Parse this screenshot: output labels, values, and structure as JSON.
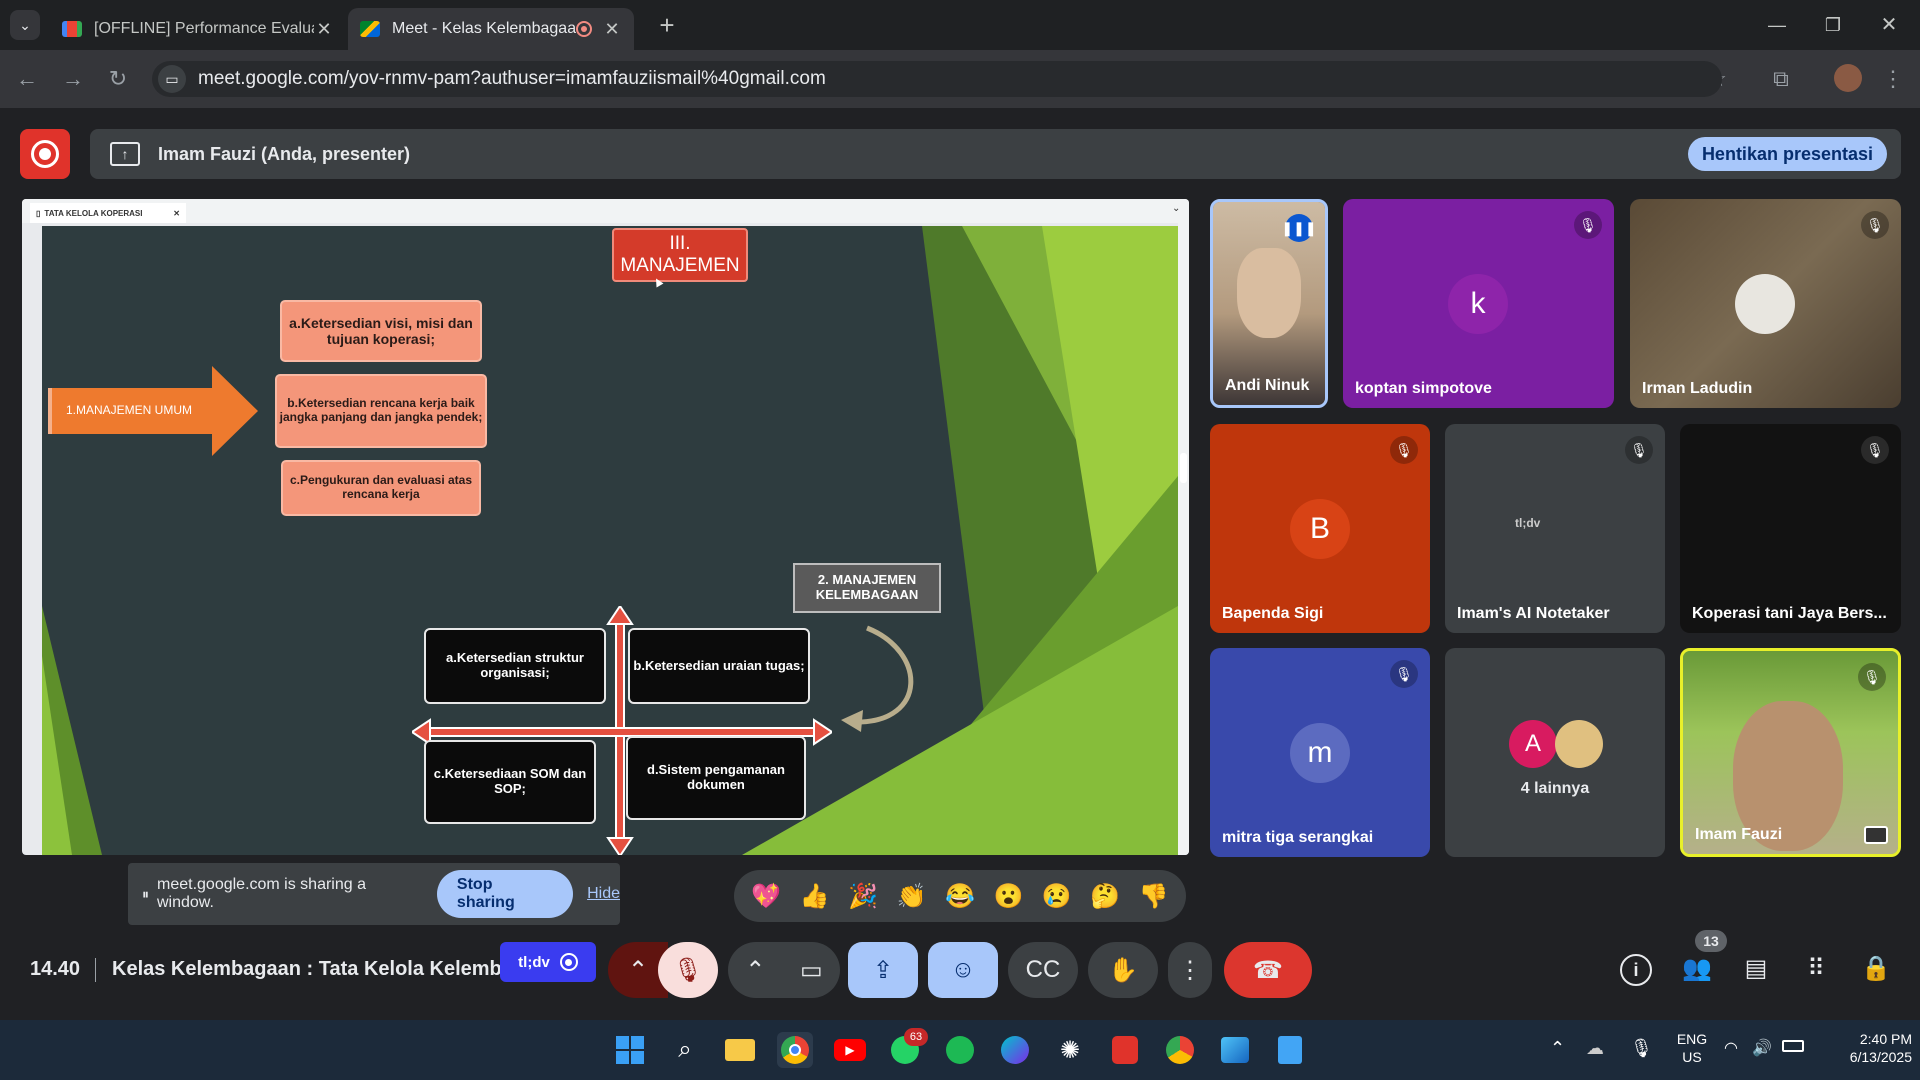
{
  "browser": {
    "tabs": [
      {
        "title": "[OFFLINE] Performance Evaluati",
        "favicon": "gmail-icon"
      },
      {
        "title": "Meet - Kelas Kelembagaan",
        "favicon": "meet-icon"
      }
    ],
    "url": "meet.google.com/yov-rnmv-pam?authuser=imamfauziismail%40gmail.com"
  },
  "presenter": {
    "label": "Imam Fauzi (Anda, presenter)",
    "stop_button": "Hentikan presentasi"
  },
  "shared_window": {
    "tab_title": "TATA KELOLA KOPERASI",
    "slide": {
      "title": "III. MANAJEMEN",
      "arrow_label": "1.MANAJEMEN UMUM",
      "box_a": "a.Ketersedian visi, misi dan tujuan koperasi;",
      "box_b": "b.Ketersedian rencana kerja baik jangka panjang dan jangka pendek;",
      "box_c": "c.Pengukuran dan evaluasi atas rencana kerja",
      "section2": "2. MANAJEMEN KELEMBAGAAN",
      "q_a": "a.Ketersedian struktur organisasi;",
      "q_b": "b.Ketersedian uraian tugas;",
      "q_c": "c.Ketersediaan SOM dan SOP;",
      "q_d": "d.Sistem pengamanan dokumen"
    }
  },
  "participants": [
    {
      "name": "Andi Ninuk",
      "initial": ""
    },
    {
      "name": "koptan simpotove",
      "initial": "k"
    },
    {
      "name": "Irman Ladudin",
      "initial": ""
    },
    {
      "name": "Bapenda Sigi",
      "initial": "B"
    },
    {
      "name": "Imam's AI Notetaker",
      "initial": "",
      "logo": "tl;dv"
    },
    {
      "name": "Koperasi tani Jaya Bers...",
      "initial": ""
    },
    {
      "name": "mitra tiga serangkai",
      "initial": "m"
    },
    {
      "name": "4 lainnya",
      "initial": "A"
    },
    {
      "name": "Imam Fauzi",
      "initial": ""
    }
  ],
  "sharing_notice": {
    "text": "meet.google.com is sharing a window.",
    "stop": "Stop sharing",
    "hide": "Hide"
  },
  "reactions": [
    "💖",
    "👍",
    "🎉",
    "👏",
    "😂",
    "😮",
    "😢",
    "🤔",
    "👎"
  ],
  "meeting": {
    "time": "14.40",
    "title": "Kelas Kelembagaan : Tata Kelola Kelembagaan",
    "tldv_label": "tl;dv",
    "people_count": "13"
  },
  "taskbar": {
    "whatsapp_badge": "63",
    "lang": "ENG",
    "region": "US",
    "time": "2:40 PM",
    "date": "6/13/2025"
  },
  "colors": {
    "meet_bg": "#202124",
    "accent_blue": "#a8c7fa",
    "end_call_red": "#e0332b"
  }
}
